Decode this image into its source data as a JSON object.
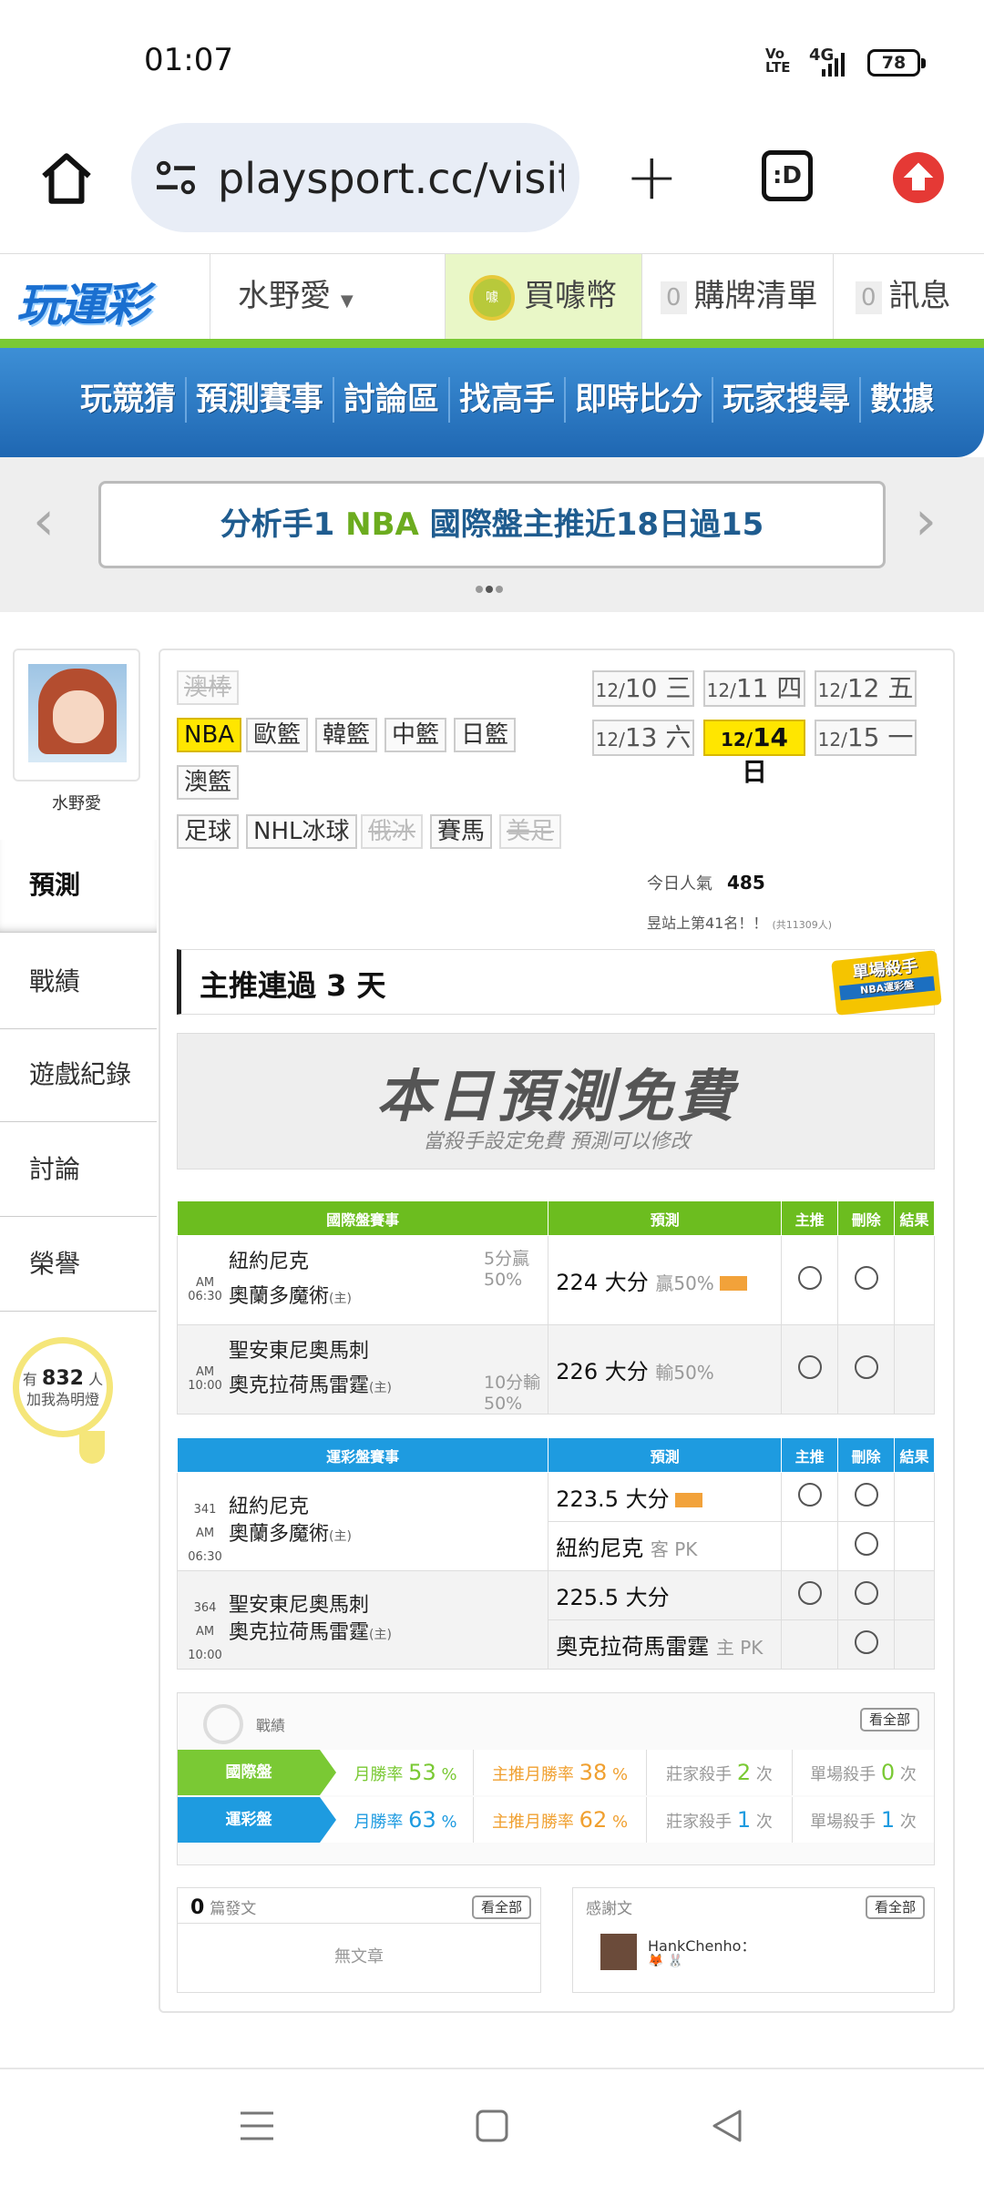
{
  "status": {
    "time": "01:07",
    "volte": "Vo LTE",
    "network": "4G",
    "battery": "78"
  },
  "browser": {
    "url": "playsport.cc/visit",
    "tabs_label": ":D"
  },
  "site": {
    "logo": "玩運彩",
    "user": "水野愛",
    "coin_label": "買噱幣",
    "coin_icon_text": "噱",
    "cart_count": "0",
    "cart_label": "購牌清單",
    "msg_count": "0",
    "msg_label": "訊息"
  },
  "nav": [
    "玩競猜",
    "預測賽事",
    "討論區",
    "找高手",
    "即時比分",
    "玩家搜尋",
    "數據"
  ],
  "banner": {
    "prefix": "分析手1 ",
    "highlight": "NBA",
    "suffix": " 國際盤主推近18日過15",
    "prev": "‹",
    "next": "›"
  },
  "sidebar": {
    "avatar_name": "水野愛",
    "menu": [
      "預測",
      "戰績",
      "遊戲紀錄",
      "討論",
      "榮譽"
    ],
    "fans_prefix": "有",
    "fans_count": "832",
    "fans_unit": "人",
    "fans_sub": "加我為明燈"
  },
  "sports": {
    "tags": [
      "澳棒",
      "NBA",
      "歐籃",
      "韓籃",
      "中籃",
      "日籃",
      "澳籃",
      "足球",
      "NHL冰球",
      "俄冰",
      "賽馬",
      "美足"
    ]
  },
  "dates": [
    {
      "m": "12/",
      "d": "10",
      "w": "三"
    },
    {
      "m": "12/",
      "d": "11",
      "w": "四"
    },
    {
      "m": "12/",
      "d": "12",
      "w": "五"
    },
    {
      "m": "12/",
      "d": "13",
      "w": "六"
    },
    {
      "m": "12/",
      "d": "14",
      "w": "日"
    },
    {
      "m": "12/",
      "d": "15",
      "w": "一"
    }
  ],
  "stats": {
    "popular_label": "今日人氣",
    "popular_value": "485",
    "rank_text": "昱站上第41名！！",
    "rank_total": "(共11309人)"
  },
  "streak": {
    "title": "主推連過 3 天",
    "badge_title": "單場殺手",
    "badge_sub": "NBA運彩盤"
  },
  "free": {
    "title": "本日預測免費",
    "subtitle": "當殺手設定免費  預測可以修改"
  },
  "intl_table": {
    "headers": [
      "國際盤賽事",
      "預測",
      "主推",
      "刪除",
      "結果"
    ],
    "rows": [
      {
        "time": "AM 06:30",
        "away": "紐約尼克",
        "home": "奧蘭多魔術",
        "home_tag": "(主)",
        "odds1": "5分贏",
        "odds2": "50%",
        "odds_row": "away",
        "pred": "224 大分",
        "pred_note": "贏50%"
      },
      {
        "time": "AM 10:00",
        "away": "聖安東尼奧馬刺",
        "home": "奧克拉荷馬雷霆",
        "home_tag": "(主)",
        "odds1": "10分輸",
        "odds2": "50%",
        "odds_row": "home",
        "pred": "226 大分",
        "pred_note": "輸50%"
      }
    ]
  },
  "tw_table": {
    "headers": [
      "運彩盤賽事",
      "預測",
      "主推",
      "刪除",
      "結果"
    ],
    "rows": [
      {
        "num": "341",
        "time": "AM 06:30",
        "away": "紐約尼克",
        "home": "奧蘭多魔術",
        "home_tag": "(主)",
        "pred1": "223.5 大分",
        "pred2": "紐約尼克",
        "pred2_note": "客 PK"
      },
      {
        "num": "364",
        "time": "AM 10:00",
        "away": "聖安東尼奧馬刺",
        "home": "奧克拉荷馬雷霆",
        "home_tag": "(主)",
        "pred1": "225.5 大分",
        "pred2": "奧克拉荷馬雷霆",
        "pred2_note": "主 PK"
      }
    ]
  },
  "record": {
    "title": "戰績",
    "view_all": "看全部",
    "rows": [
      {
        "label": "國際盤",
        "color": "#7ac934",
        "month_label": "月勝率",
        "month": "53",
        "main_label": "主推月勝率",
        "main": "38",
        "killer_label": "莊家殺手",
        "killer": "2",
        "single_label": "單場殺手",
        "single": "0",
        "pct": "%",
        "unit": "次"
      },
      {
        "label": "運彩盤",
        "color": "#1e9be0",
        "month_label": "月勝率",
        "month": "63",
        "main_label": "主推月勝率",
        "main": "62",
        "killer_label": "莊家殺手",
        "killer": "1",
        "single_label": "單場殺手",
        "single": "1",
        "pct": "%",
        "unit": "次"
      }
    ]
  },
  "posts": {
    "count": "0",
    "label": "篇發文",
    "view_all": "看全部",
    "empty": "無文章"
  },
  "thanks": {
    "label": "感謝文",
    "view_all": "看全部",
    "user": "HankChenho：",
    "emoji": "🦊 🐰"
  }
}
